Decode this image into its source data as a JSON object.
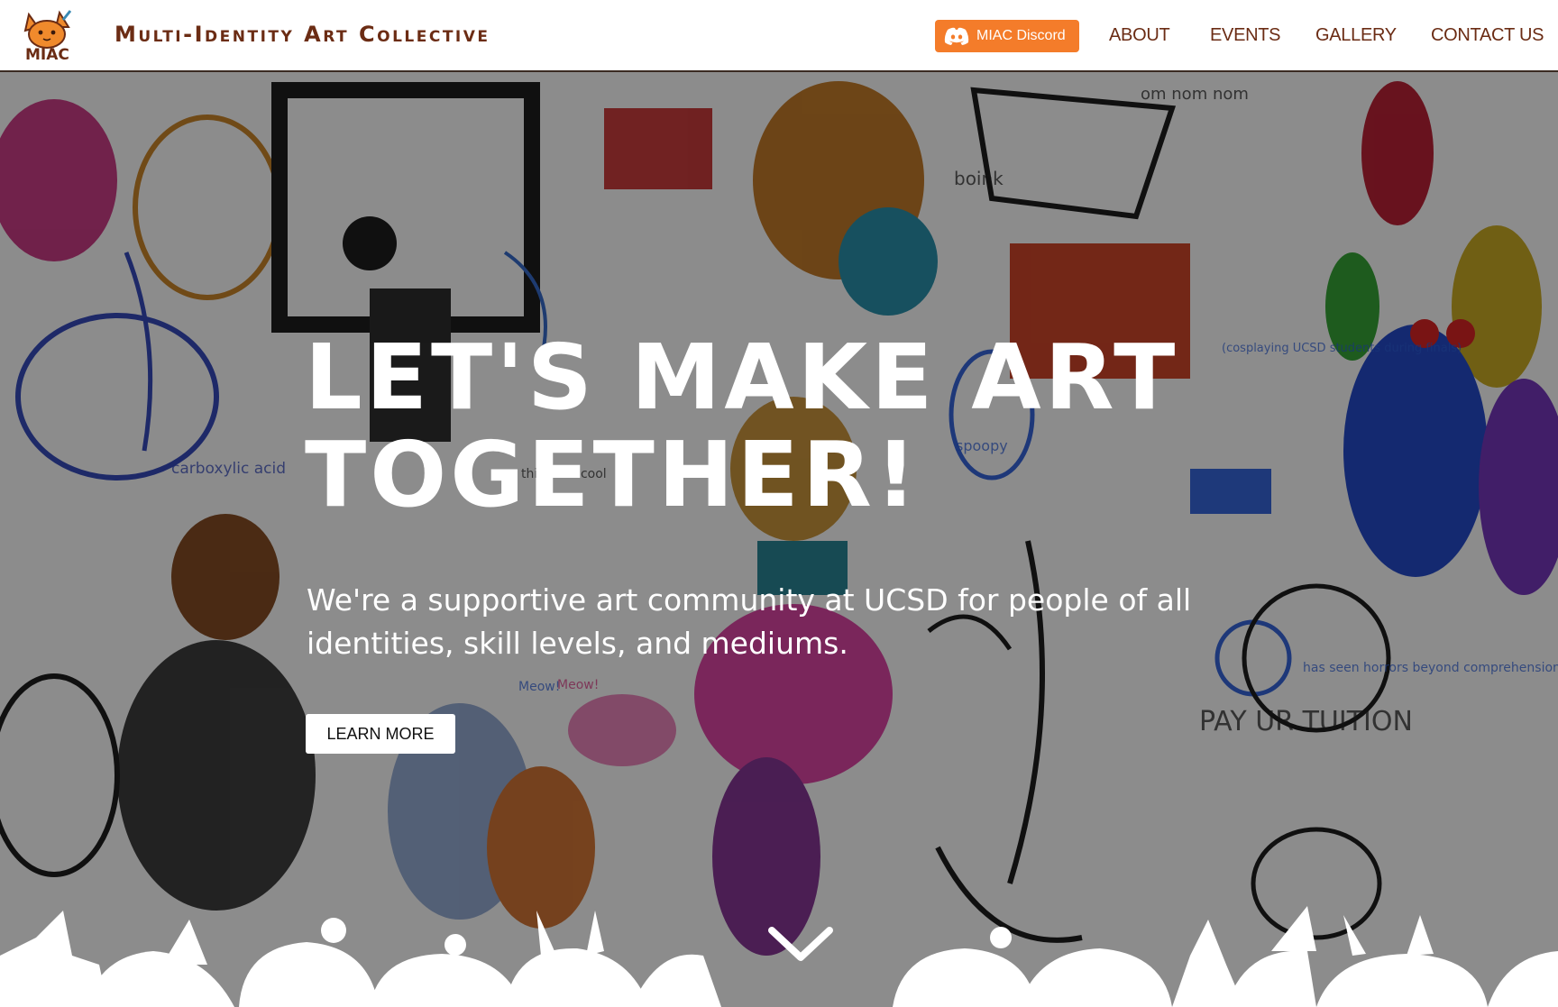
{
  "nav": {
    "logo_text": "MIAC",
    "title": "Multi-Identity Art Collective",
    "discord_label": "MIAC Discord",
    "links": [
      {
        "label": "ABOUT"
      },
      {
        "label": "EVENTS"
      },
      {
        "label": "GALLERY"
      },
      {
        "label": "CONTACT US"
      }
    ]
  },
  "hero": {
    "headline": "LET'S MAKE ART TOGETHER!",
    "subtext": "We're a supportive art community at UCSD for people of all identities, skill levels, and mediums.",
    "cta_label": "LEARN MORE",
    "doodle_texts": [
      "om nom nom",
      "boink",
      "carboxylic acid",
      "spoopy",
      "(cosplaying UCSD students during finals)",
      "has seen horrors beyond comprehension",
      "PAY UR TUITION",
      "Meow!",
      "Meow!",
      "this is so cool"
    ]
  },
  "icons": {
    "discord": "discord-icon",
    "scroll": "chevron-down-icon",
    "logo": "fox-mascot-logo"
  },
  "colors": {
    "brand_brown": "#6b2c14",
    "discord_orange": "#f47c2a",
    "hero_overlay": "rgba(0,0,0,0.42)",
    "text_on_hero": "#ffffff"
  }
}
